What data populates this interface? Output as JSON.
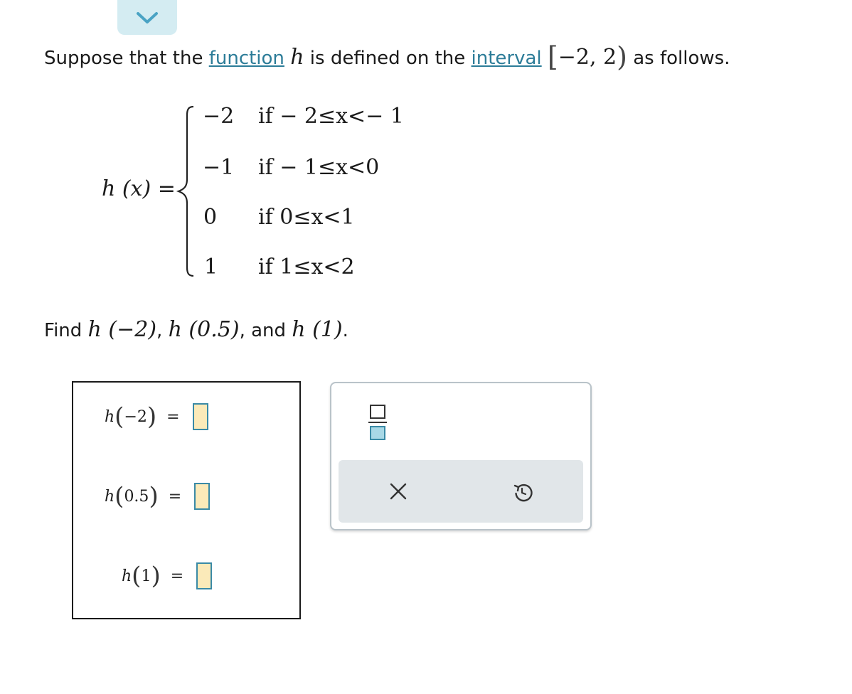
{
  "problem": {
    "intro_prefix": "Suppose that the ",
    "function_link": "function",
    "function_var": "h",
    "intro_mid": " is defined on the ",
    "interval_link": "interval",
    "interval_open": "[",
    "interval_body": "−2,  2",
    "interval_close": ")",
    "intro_suffix": " as follows."
  },
  "definition": {
    "lhs": "h (x) =",
    "cases": [
      {
        "value": "−2",
        "condition": "if  − 2≤x<− 1"
      },
      {
        "value": "−1",
        "condition": "if  − 1≤x<0"
      },
      {
        "value": "0",
        "condition": "if  0≤x<1"
      },
      {
        "value": "1",
        "condition": "if  1≤x<2"
      }
    ]
  },
  "prompt": {
    "find": "Find ",
    "expr1": "h (−2)",
    "sep1": ", ",
    "expr2": "h (0.5)",
    "sep2": ", and ",
    "expr3": "h (1)",
    "end": "."
  },
  "answers": [
    {
      "func": "h",
      "arg": "−2",
      "equals": "=",
      "value": ""
    },
    {
      "func": "h",
      "arg": "0.5",
      "equals": "=",
      "value": ""
    },
    {
      "func": "h",
      "arg": "1",
      "equals": "=",
      "value": ""
    }
  ],
  "keypad": {
    "keys": [
      "fraction-icon"
    ],
    "toolbar": [
      "clear-icon",
      "undo-icon"
    ],
    "accent_color": "#3a8aa6",
    "input_fill_color": "#fbeab9"
  },
  "header": {
    "collapse_icon": "chevron-down-icon",
    "color": "#d4ecf2"
  }
}
